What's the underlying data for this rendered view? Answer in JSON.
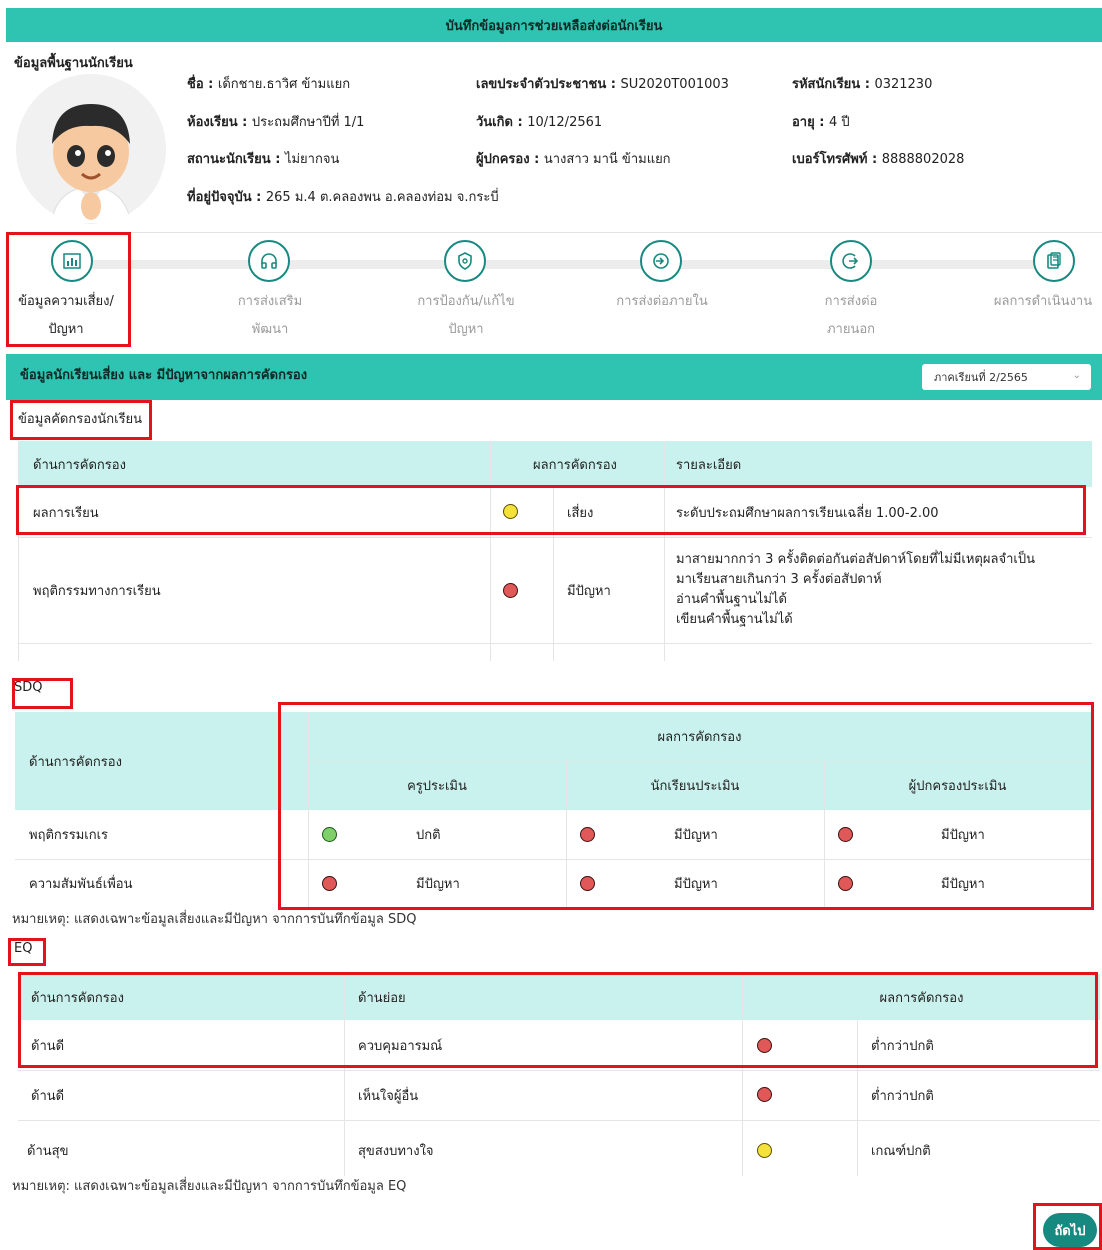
{
  "header": {
    "title": "บันทึกข้อมูลการช่วยเหลือส่งต่อนักเรียน"
  },
  "student": {
    "section_title": "ข้อมูลพื้นฐานนักเรียน",
    "name_label": "ชื่อ",
    "name": "เด็กชาย.ธาวิศ ข้ามแยก",
    "citizen_label": "เลขประจำตัวประชาชน",
    "citizen": "SU2020T001003",
    "student_id_label": "รหัสนักเรียน",
    "student_id": "0321230",
    "classroom_label": "ห้องเรียน",
    "classroom": "ประถมศึกษาปีที่ 1/1",
    "birthdate_label": "วันเกิด",
    "birthdate": "10/12/2561",
    "age_label": "อายุ",
    "age": "4 ปี",
    "status_label": "สถานะนักเรียน",
    "status": "ไม่ยากจน",
    "guardian_label": "ผู้ปกครอง",
    "guardian": "นางสาว มานี ข้ามแยก",
    "phone_label": "เบอร์โทรศัพท์",
    "phone": "8888802028",
    "address_label": "ที่อยู่ปัจจุบัน",
    "address": "265 ม.4 ต.คลองพน อ.คลองท่อม จ.กระบี่"
  },
  "steps": [
    {
      "line1": "ข้อมูลความเสี่ยง/",
      "line2": "ปัญหา",
      "icon": "chart-icon"
    },
    {
      "line1": "การส่งเสริม",
      "line2": "พัฒนา",
      "icon": "headphones-icon"
    },
    {
      "line1": "การป้องกัน/แก้ไข",
      "line2": "ปัญหา",
      "icon": "shield-icon"
    },
    {
      "line1": "การส่งต่อภายใน",
      "line2": "",
      "icon": "login-icon"
    },
    {
      "line1": "การส่งต่อ",
      "line2": "ภายนอก",
      "icon": "logout-icon"
    },
    {
      "line1": "ผลการดำเนินงาน",
      "line2": "",
      "icon": "clipboard-icon"
    }
  ],
  "risk_section": {
    "band_title": "ข้อมูลนักเรียนเสี่ยง และ มีปัญหาจากผลการคัดกรอง",
    "semester": "ภาคเรียนที่ 2/2565",
    "screening_title": "ข้อมูลคัดกรองนักเรียน",
    "columns": [
      "ด้านการคัดกรอง",
      "ผลการคัดกรอง",
      "รายละเอียด"
    ],
    "rows": [
      {
        "aspect": "ผลการเรียน",
        "face": "yellow",
        "result": "เสี่ยง",
        "detail": [
          "ระดับประถมศึกษาผลการเรียนเฉลี่ย 1.00-2.00"
        ]
      },
      {
        "aspect": "พฤติกรรมทางการเรียน",
        "face": "red",
        "result": "มีปัญหา",
        "detail": [
          "มาสายมากกว่า 3 ครั้งติดต่อกันต่อสัปดาห์โดยที่ไม่มีเหตุผลจำเป็น",
          "มาเรียนสายเกินกว่า 3 ครั้งต่อสัปดาห์",
          "อ่านคำพื้นฐานไม่ได้",
          "เขียนคำพื้นฐานไม่ได้"
        ]
      }
    ]
  },
  "sdq": {
    "title": "SDQ",
    "aspect_header": "ด้านการคัดกรอง",
    "result_header": "ผลการคัดกรอง",
    "sub_headers": [
      "ครูประเมิน",
      "นักเรียนประเมิน",
      "ผู้ปกครองประเมิน"
    ],
    "rows": [
      {
        "aspect": "พฤติกรรมเกเร",
        "results": [
          {
            "face": "green",
            "text": "ปกติ"
          },
          {
            "face": "red",
            "text": "มีปัญหา"
          },
          {
            "face": "red",
            "text": "มีปัญหา"
          }
        ]
      },
      {
        "aspect": "ความสัมพันธ์เพื่อน",
        "results": [
          {
            "face": "red",
            "text": "มีปัญหา"
          },
          {
            "face": "red",
            "text": "มีปัญหา"
          },
          {
            "face": "red",
            "text": "มีปัญหา"
          }
        ]
      }
    ],
    "note": "หมายเหตุ: แสดงเฉพาะข้อมูลเสี่ยงและมีปัญหา จากการบันทึกข้อมูล SDQ"
  },
  "eq": {
    "title": "EQ",
    "columns": [
      "ด้านการคัดกรอง",
      "ด้านย่อย",
      "ผลการคัดกรอง"
    ],
    "rows": [
      {
        "aspect": "ด้านดี",
        "sub": "ควบคุมอารมณ์",
        "face": "red",
        "result": "ต่ำกว่าปกติ"
      },
      {
        "aspect": "ด้านดี",
        "sub": "เห็นใจผู้อื่น",
        "face": "red",
        "result": "ต่ำกว่าปกติ"
      },
      {
        "aspect": "ด้านสุข",
        "sub": "สุขสงบทางใจ",
        "face": "yellow",
        "result": "เกณฑ์ปกติ"
      }
    ],
    "note": "หมายเหตุ: แสดงเฉพาะข้อมูลเสี่ยงและมีปัญหา จากการบันทึกข้อมูล EQ"
  },
  "footer": {
    "next_label": "ถัดไป"
  },
  "colors": {
    "teal": "#2fc4b2",
    "dark_teal": "#168a80",
    "table_header": "#c9f1ee",
    "highlight_red": "#e2131b"
  }
}
